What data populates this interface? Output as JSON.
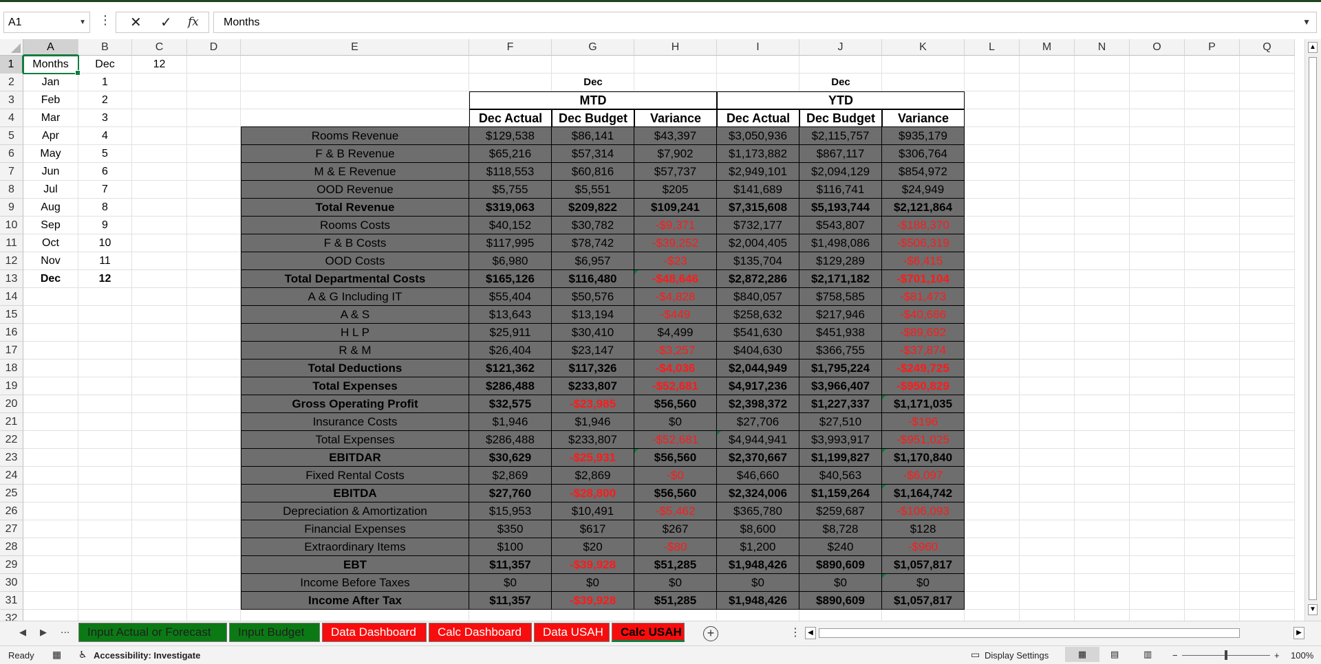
{
  "formula_bar": {
    "name_box": "A1",
    "content": "Months",
    "cancel_icon": "x-icon",
    "enter_icon": "check-icon",
    "fx_label": "fx"
  },
  "columns": [
    "A",
    "B",
    "C",
    "D",
    "E",
    "F",
    "G",
    "H",
    "I",
    "J",
    "K",
    "L",
    "M",
    "N",
    "O",
    "P",
    "Q"
  ],
  "rows": [
    "1",
    "2",
    "3",
    "4",
    "5",
    "6",
    "7",
    "8",
    "9",
    "10",
    "11",
    "12",
    "13",
    "14",
    "15",
    "16",
    "17",
    "18",
    "19",
    "20",
    "21",
    "22",
    "23",
    "24",
    "25",
    "26",
    "27",
    "28",
    "29",
    "30",
    "31",
    "32"
  ],
  "month_list": {
    "header": [
      "Months",
      "Dec",
      "12"
    ],
    "months": [
      [
        "Jan",
        "1"
      ],
      [
        "Feb",
        "2"
      ],
      [
        "Mar",
        "3"
      ],
      [
        "Apr",
        "4"
      ],
      [
        "May",
        "5"
      ],
      [
        "Jun",
        "6"
      ],
      [
        "Jul",
        "7"
      ],
      [
        "Aug",
        "8"
      ],
      [
        "Sep",
        "9"
      ],
      [
        "Oct",
        "10"
      ],
      [
        "Nov",
        "11"
      ],
      [
        "Dec",
        "12"
      ]
    ]
  },
  "report": {
    "mtd_month": "Dec",
    "ytd_month": "Dec",
    "mtd_label": "MTD",
    "ytd_label": "YTD",
    "col_headers": [
      "Dec Actual",
      "Dec Budget",
      "Variance",
      "Dec Actual",
      "Dec Budget",
      "Variance"
    ],
    "lines": [
      {
        "label": "Rooms Revenue",
        "bold": false,
        "values": [
          "$129,538",
          "$86,141",
          "$43,397",
          "$3,050,936",
          "$2,115,757",
          "$935,179"
        ]
      },
      {
        "label": "F & B Revenue",
        "bold": false,
        "values": [
          "$65,216",
          "$57,314",
          "$7,902",
          "$1,173,882",
          "$867,117",
          "$306,764"
        ]
      },
      {
        "label": "M & E Revenue",
        "bold": false,
        "values": [
          "$118,553",
          "$60,816",
          "$57,737",
          "$2,949,101",
          "$2,094,129",
          "$854,972"
        ]
      },
      {
        "label": "OOD Revenue",
        "bold": false,
        "values": [
          "$5,755",
          "$5,551",
          "$205",
          "$141,689",
          "$116,741",
          "$24,949"
        ]
      },
      {
        "label": "Total Revenue",
        "bold": true,
        "values": [
          "$319,063",
          "$209,822",
          "$109,241",
          "$7,315,608",
          "$5,193,744",
          "$2,121,864"
        ]
      },
      {
        "label": "Rooms Costs",
        "bold": false,
        "values": [
          "$40,152",
          "$30,782",
          "-$9,371",
          "$732,177",
          "$543,807",
          "-$188,370"
        ]
      },
      {
        "label": "F & B Costs",
        "bold": false,
        "values": [
          "$117,995",
          "$78,742",
          "-$39,252",
          "$2,004,405",
          "$1,498,086",
          "-$506,319"
        ]
      },
      {
        "label": "OOD Costs",
        "bold": false,
        "values": [
          "$6,980",
          "$6,957",
          "-$23",
          "$135,704",
          "$129,289",
          "-$6,415"
        ]
      },
      {
        "label": "Total Departmental Costs",
        "bold": true,
        "values": [
          "$165,126",
          "$116,480",
          "-$48,646",
          "$2,872,286",
          "$2,171,182",
          "-$701,104"
        ]
      },
      {
        "label": "A & G Including IT",
        "bold": false,
        "values": [
          "$55,404",
          "$50,576",
          "-$4,828",
          "$840,057",
          "$758,585",
          "-$81,473"
        ]
      },
      {
        "label": "A & S",
        "bold": false,
        "values": [
          "$13,643",
          "$13,194",
          "-$449",
          "$258,632",
          "$217,946",
          "-$40,686"
        ]
      },
      {
        "label": "H L P",
        "bold": false,
        "values": [
          "$25,911",
          "$30,410",
          "$4,499",
          "$541,630",
          "$451,938",
          "-$89,692"
        ]
      },
      {
        "label": "R & M",
        "bold": false,
        "values": [
          "$26,404",
          "$23,147",
          "-$3,257",
          "$404,630",
          "$366,755",
          "-$37,874"
        ]
      },
      {
        "label": "Total Deductions",
        "bold": true,
        "values": [
          "$121,362",
          "$117,326",
          "-$4,036",
          "$2,044,949",
          "$1,795,224",
          "-$249,725"
        ]
      },
      {
        "label": "Total Expenses",
        "bold": true,
        "values": [
          "$286,488",
          "$233,807",
          "-$52,681",
          "$4,917,236",
          "$3,966,407",
          "-$950,829"
        ]
      },
      {
        "label": "Gross Operating Profit",
        "bold": true,
        "values": [
          "$32,575",
          "-$23,985",
          "$56,560",
          "$2,398,372",
          "$1,227,337",
          "$1,171,035"
        ]
      },
      {
        "label": "Insurance Costs",
        "bold": false,
        "values": [
          "$1,946",
          "$1,946",
          "$0",
          "$27,706",
          "$27,510",
          "-$196"
        ]
      },
      {
        "label": "Total Expenses",
        "bold": false,
        "values": [
          "$286,488",
          "$233,807",
          "-$52,681",
          "$4,944,941",
          "$3,993,917",
          "-$951,025"
        ]
      },
      {
        "label": "EBITDAR",
        "bold": true,
        "values": [
          "$30,629",
          "-$25,931",
          "$56,560",
          "$2,370,667",
          "$1,199,827",
          "$1,170,840"
        ]
      },
      {
        "label": "Fixed Rental Costs",
        "bold": false,
        "values": [
          "$2,869",
          "$2,869",
          "-$0",
          "$46,660",
          "$40,563",
          "-$6,097"
        ]
      },
      {
        "label": "EBITDA",
        "bold": true,
        "values": [
          "$27,760",
          "-$28,800",
          "$56,560",
          "$2,324,006",
          "$1,159,264",
          "$1,164,742"
        ]
      },
      {
        "label": "Depreciation & Amortization",
        "bold": false,
        "values": [
          "$15,953",
          "$10,491",
          "-$5,462",
          "$365,780",
          "$259,687",
          "-$106,093"
        ]
      },
      {
        "label": "Financial Expenses",
        "bold": false,
        "values": [
          "$350",
          "$617",
          "$267",
          "$8,600",
          "$8,728",
          "$128"
        ]
      },
      {
        "label": "Extraordinary Items",
        "bold": false,
        "values": [
          "$100",
          "$20",
          "-$80",
          "$1,200",
          "$240",
          "-$960"
        ]
      },
      {
        "label": "EBT",
        "bold": true,
        "values": [
          "$11,357",
          "-$39,928",
          "$51,285",
          "$1,948,426",
          "$890,609",
          "$1,057,817"
        ]
      },
      {
        "label": "Income Before Taxes",
        "bold": false,
        "values": [
          "$0",
          "$0",
          "$0",
          "$0",
          "$0",
          "$0"
        ]
      },
      {
        "label": "Income After Tax",
        "bold": true,
        "values": [
          "$11,357",
          "-$39,928",
          "$51,285",
          "$1,948,426",
          "$890,609",
          "$1,057,817"
        ]
      }
    ]
  },
  "sheet_tabs": [
    {
      "label": "Input Actual or Forecast",
      "style": "green"
    },
    {
      "label": "Input Budget",
      "style": "green"
    },
    {
      "label": "Data Dashboard",
      "style": "red"
    },
    {
      "label": "Calc Dashboard",
      "style": "red"
    },
    {
      "label": "Data USAH",
      "style": "red"
    },
    {
      "label": "Calc USAH",
      "style": "active"
    }
  ],
  "tab_nav": {
    "prev": "◀",
    "next": "▶",
    "more": "..."
  },
  "status_bar": {
    "ready": "Ready",
    "accessibility": "Accessibility: Investigate",
    "display_settings": "Display Settings",
    "zoom_minus": "−",
    "zoom_plus": "+",
    "zoom": "100%"
  },
  "colors": {
    "accent": "#107c41",
    "dark_fill": "#6e6e6e",
    "negative": "#ff1a1a",
    "tab_green": "#0b7a14",
    "tab_red": "#f70d0d"
  }
}
